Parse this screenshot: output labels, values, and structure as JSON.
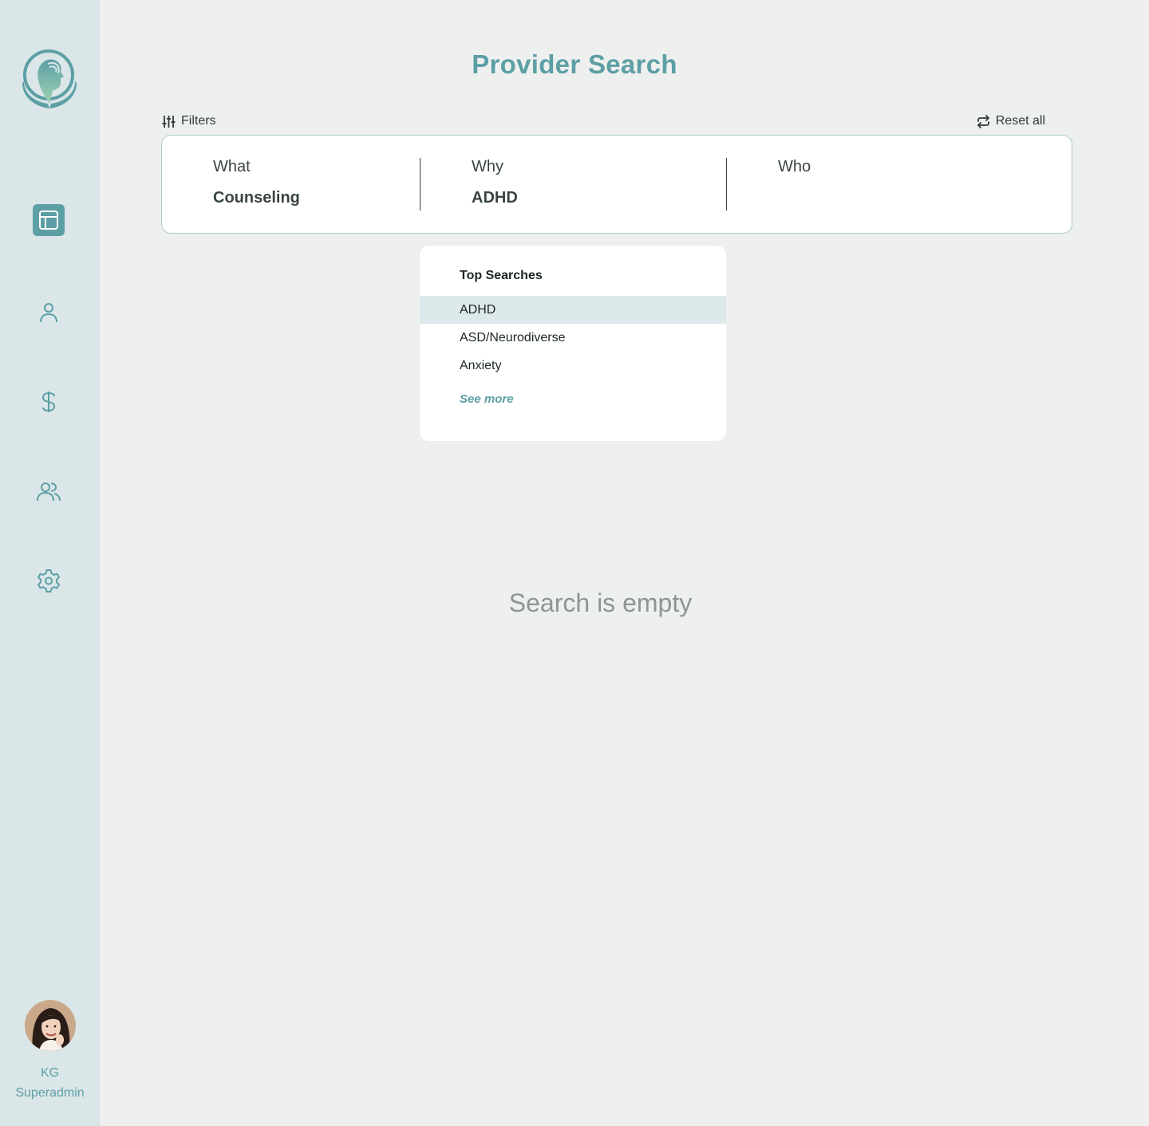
{
  "page": {
    "title": "Provider Search"
  },
  "filters": {
    "label": "Filters",
    "reset_label": "Reset all",
    "what": {
      "label": "What",
      "value": "Counseling"
    },
    "why": {
      "label": "Why",
      "value": "ADHD"
    },
    "who": {
      "label": "Who",
      "value": ""
    }
  },
  "top_searches": {
    "title": "Top Searches",
    "items": [
      "ADHD",
      "ASD/Neurodiverse",
      "Anxiety"
    ],
    "highlighted_index": 0,
    "see_more": "See more"
  },
  "empty_state": "Search is empty",
  "user": {
    "initials": "KG",
    "role": "Superadmin"
  },
  "nav": {
    "items": [
      "dashboard-icon",
      "user-icon",
      "dollar-icon",
      "users-icon",
      "gear-icon"
    ],
    "active": "dashboard-icon"
  },
  "colors": {
    "accent": "#5c9fa5",
    "sidebar_bg": "#dae6e8",
    "page_bg": "#eef0ef",
    "highlight": "#dde9eb"
  }
}
